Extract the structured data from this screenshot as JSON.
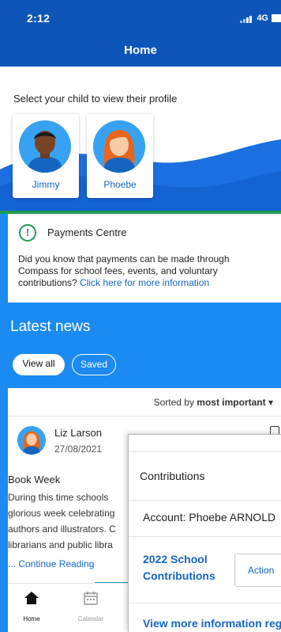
{
  "status_bar": {
    "time": "2:12",
    "network": "4G",
    "signal_icon": "signal-icon",
    "battery_icon": "battery-icon"
  },
  "header": {
    "title": "Home"
  },
  "children_section": {
    "prompt": "Select your child to view their profile",
    "children": [
      {
        "name": "Jimmy",
        "icon": "boy-avatar-icon"
      },
      {
        "name": "Phoebe",
        "icon": "girl-avatar-icon"
      }
    ]
  },
  "payments": {
    "title": "Payments Centre",
    "text": "Did you know that payments can be made through Compass for school fees, events, and voluntary contributions?",
    "link": "Click here for more information",
    "icon": "alert-icon",
    "accent_color": "#1d9a55"
  },
  "news": {
    "title": "Latest news",
    "filters": {
      "all": "View all",
      "saved": "Saved"
    },
    "sort_prefix": "Sorted by",
    "sort_value": "most important",
    "item": {
      "author": "Liz Larson",
      "date": "27/08/2021",
      "heading": "Book Week",
      "body_lines": [
        "During this time schools",
        "glorious week celebrating",
        "authors and illustrators. C",
        "librarians and public libra"
      ],
      "more": "... Continue Reading"
    }
  },
  "bottom_nav": [
    {
      "label": "Home",
      "icon": "home-icon"
    },
    {
      "label": "Calendar",
      "icon": "calendar-icon"
    }
  ],
  "popup": {
    "title": "Contributions",
    "account": "Account: Phoebe ARNOLD",
    "contribution": "2022 School Contributions",
    "action": "Action",
    "view_more": "View more information reg"
  },
  "colors": {
    "brand_dark": "#0d56b8",
    "brand_light": "#1b8bf2",
    "link": "#1466c3"
  }
}
